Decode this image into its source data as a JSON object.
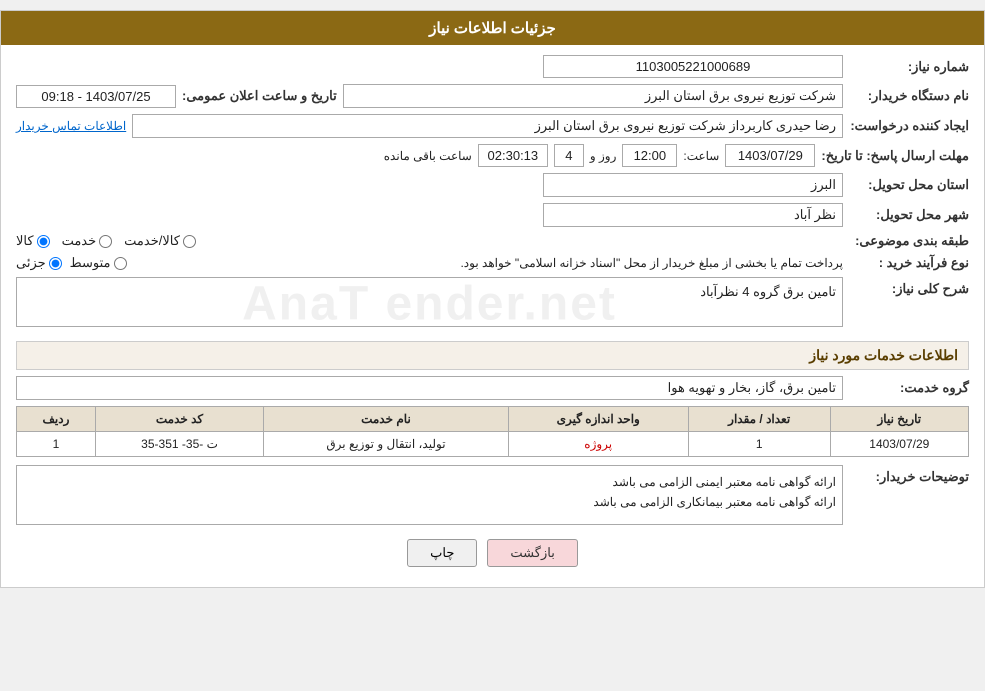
{
  "header": {
    "title": "جزئیات اطلاعات نیاز"
  },
  "fields": {
    "shomara_niaz_label": "شماره نیاز:",
    "shomara_niaz_value": "1103005221000689",
    "nam_dasgah_label": "نام دستگاه خریدار:",
    "nam_dasgah_value": "شرکت توزیع نیروی برق استان البرز",
    "tarikh_label": "تاریخ و ساعت اعلان عمومی:",
    "tarikh_value": "1403/07/25 - 09:18",
    "ijad_label": "ایجاد کننده درخواست:",
    "ijad_value": "رضا حیدری کاربرداز شرکت توزیع نیروی برق استان البرز",
    "ettelaat_tamas": "اطلاعات تماس خریدار",
    "mohlat_label": "مهلت ارسال پاسخ: تا تاریخ:",
    "mohlat_date": "1403/07/29",
    "mohlat_saat_label": "ساعت:",
    "mohlat_saat": "12:00",
    "mohlat_rooz_label": "روز و",
    "mohlat_rooz": "4",
    "mohlat_mande_label": "ساعت باقی مانده",
    "mohlat_mande": "02:30:13",
    "ostan_label": "استان محل تحویل:",
    "ostan_value": "البرز",
    "shahr_label": "شهر محل تحویل:",
    "shahr_value": "نظر آباد",
    "tabaqe_label": "طبقه بندی موضوعی:",
    "tabaqe_kala": "کالا",
    "tabaqe_khadamat": "خدمت",
    "tabaqe_kala_khadamat": "کالا/خدمت",
    "nove_farayand_label": "نوع فرآیند خرید :",
    "nove_farayand_jozei": "جزئی",
    "nove_farayand_motavaset": "متوسط",
    "nove_farayand_text": "پرداخت تمام یا بخشی از مبلغ خریدار از محل \"اسناد خزانه اسلامی\" خواهد بود.",
    "sharh_label": "شرح کلی نیاز:",
    "sharh_value": "تامین برق گروه 4 نظرآباد",
    "khadamat_section": "اطلاعات خدمات مورد نیاز",
    "goroh_khadamat_label": "گروه خدمت:",
    "goroh_khadamat_value": "تامین برق، گاز، بخار و تهویه هوا",
    "table": {
      "headers": [
        "ردیف",
        "کد خدمت",
        "نام خدمت",
        "واحد اندازه گیری",
        "تعداد / مقدار",
        "تاریخ نیاز"
      ],
      "rows": [
        {
          "radif": "1",
          "code": "ت -35- 351-35",
          "name": "تولید، انتقال و توزیع برق",
          "vahed": "پروژه",
          "tedad": "1",
          "tarikh": "1403/07/29"
        }
      ]
    },
    "tosihaat_label": "توضیحات خریدار:",
    "tosihaat_line1": "ارائه گواهی نامه معتبر ایمنی الزامی می باشد",
    "tosihaat_line2": "ارائه گواهی نامه معتبر بیمانکاری الزامی می باشد"
  },
  "buttons": {
    "chap_label": "چاپ",
    "bazgasht_label": "بازگشت"
  }
}
